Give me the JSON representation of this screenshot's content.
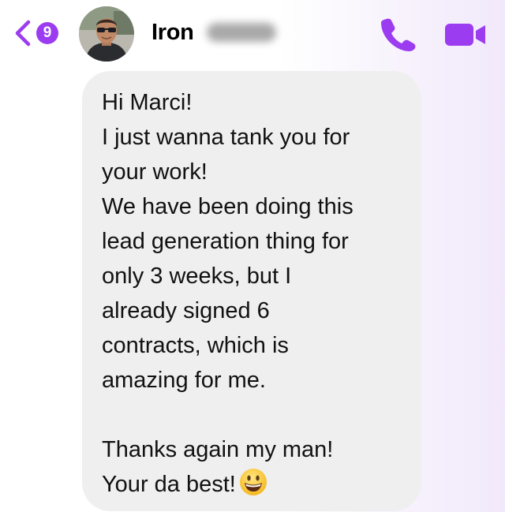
{
  "header": {
    "unread_count": "9",
    "contact_first_name": "Iron",
    "back_icon": "chevron-left-icon",
    "call_icon": "phone-icon",
    "video_icon": "video-camera-icon",
    "accent_color": "#9b3cf0"
  },
  "message": {
    "lines": [
      "Hi Marci!",
      "I just wanna tank you for",
      "your work!",
      "We have been doing this",
      "lead generation thing for",
      "only 3 weeks, but I",
      "already signed 6",
      "contracts, which is",
      "amazing for me.",
      "",
      "Thanks again my man!",
      "Your da best!"
    ],
    "emoji": "grinning-face-emoji",
    "bubble_color": "#efeff0"
  }
}
